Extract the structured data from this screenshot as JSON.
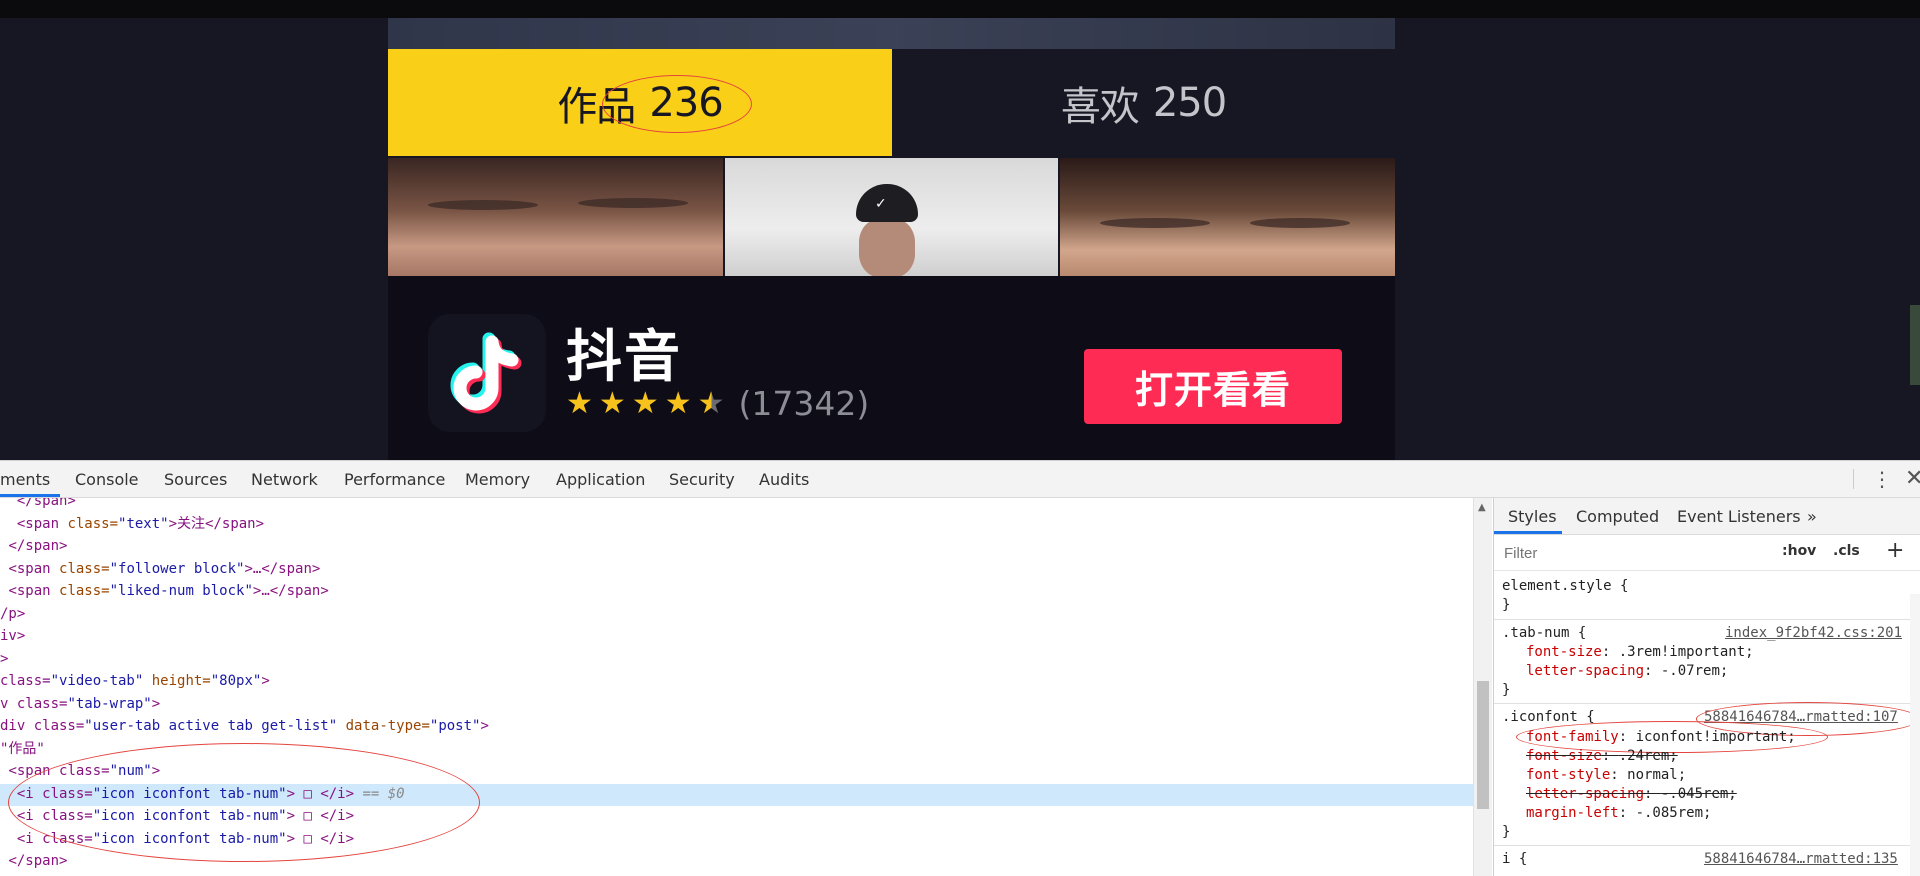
{
  "profile_tabs": {
    "works_label": "作品",
    "works_count": "236",
    "likes_label": "喜欢",
    "likes_count": "250"
  },
  "thumbnails": [
    {
      "icon": "photo-thumbnail"
    },
    {
      "icon": "photo-thumbnail"
    },
    {
      "icon": "photo-thumbnail"
    }
  ],
  "app_promo": {
    "app_name": "抖音",
    "rating_count": "(17342)",
    "rating_stars": 4.5,
    "open_button": "打开看看",
    "logo_icon": "tiktok-note-icon"
  },
  "devtools": {
    "tabs": [
      "ments",
      "Console",
      "Sources",
      "Network",
      "Performance",
      "Memory",
      "Application",
      "Security",
      "Audits"
    ],
    "dom_lines": [
      {
        "prefix": "  ",
        "tag_open": "</span>",
        "rest": ""
      },
      {
        "prefix": "  ",
        "tag_open": "<span ",
        "attr": "class",
        "val": "\"text\"",
        "text": ">关注",
        "close": "</span>"
      },
      {
        "prefix": " ",
        "tag_open": "</span>",
        "rest": ""
      },
      {
        "prefix": " ",
        "tag_open": "<span ",
        "attr": "class",
        "val": "\"follower block\"",
        "text": ">…",
        "close": "</span>"
      },
      {
        "prefix": " ",
        "tag_open": "<span ",
        "attr": "class",
        "val": "\"liked-num block\"",
        "text": ">…",
        "close": "</span>"
      },
      {
        "prefix": "",
        "tag_open": "/p>",
        "rest": ""
      },
      {
        "prefix": "",
        "tag_open": "iv>",
        "rest": ""
      },
      {
        "prefix": "",
        "tag_open": ">",
        "rest": ""
      },
      {
        "prefix": "",
        "tag_open": "class=",
        "attr": "",
        "val": "\"video-tab\"",
        "attr2": " height=",
        "val2": "\"80px\"",
        "text": ">",
        "close": ""
      },
      {
        "prefix": "",
        "tag_open": "v class=",
        "attr": "",
        "val": "\"tab-wrap\"",
        "text": ">",
        "close": ""
      },
      {
        "prefix": "",
        "tag_open": "div class=",
        "attr": "",
        "val": "\"user-tab active tab get-list\"",
        "attr2": " data-type=",
        "val2": "\"post\"",
        "text": ">",
        "close": ""
      },
      {
        "prefix": "",
        "tag_open": "",
        "attr": "",
        "val": "",
        "text": "\"作品\"",
        "close": ""
      },
      {
        "prefix": " ",
        "tag_open": "<span class=",
        "attr": "",
        "val": "\"num\"",
        "text": ">",
        "close": ""
      },
      {
        "prefix": "  ",
        "tag_open": "<i class=",
        "attr": "",
        "val": "\"icon iconfont tab-num\"",
        "text": "> □ ",
        "close": "</i>",
        "comment": " == $0"
      },
      {
        "prefix": "  ",
        "tag_open": "<i class=",
        "attr": "",
        "val": "\"icon iconfont tab-num\"",
        "text": "> □ ",
        "close": "</i>"
      },
      {
        "prefix": "  ",
        "tag_open": "<i class=",
        "attr": "",
        "val": "\"icon iconfont tab-num\"",
        "text": "> □ ",
        "close": "</i>"
      },
      {
        "prefix": " ",
        "tag_open": "</span>",
        "rest": ""
      }
    ],
    "styles_tabs": [
      "Styles",
      "Computed",
      "Event Listeners",
      "»"
    ],
    "filter_placeholder": "Filter",
    "hov": ":hov",
    "cls": ".cls",
    "plus": "+",
    "rules": {
      "element_style": "element.style {",
      "tab_num_selector": ".tab-num {",
      "tab_num_source": "index_9f2bf42.css:201",
      "tab_num_props": [
        {
          "name": "font-size",
          "value": ".3rem!important;"
        },
        {
          "name": "letter-spacing",
          "value": "-.07rem;"
        }
      ],
      "iconfont_selector": ".iconfont {",
      "iconfont_source": "58841646784…rmatted:107",
      "iconfont_props": [
        {
          "name": "font-family",
          "value": "iconfont!important;",
          "struck": false
        },
        {
          "name": "font-size",
          "value": ".24rem;",
          "struck": true
        },
        {
          "name": "font-style",
          "value": "normal;",
          "struck": false
        },
        {
          "name": "letter-spacing",
          "value": "-.045rem;",
          "struck": true
        },
        {
          "name": "margin-left",
          "value": "-.085rem;",
          "struck": false
        }
      ],
      "close_brace": "}",
      "i_selector": "i {",
      "i_source": "58841646784…rmatted:135"
    }
  }
}
